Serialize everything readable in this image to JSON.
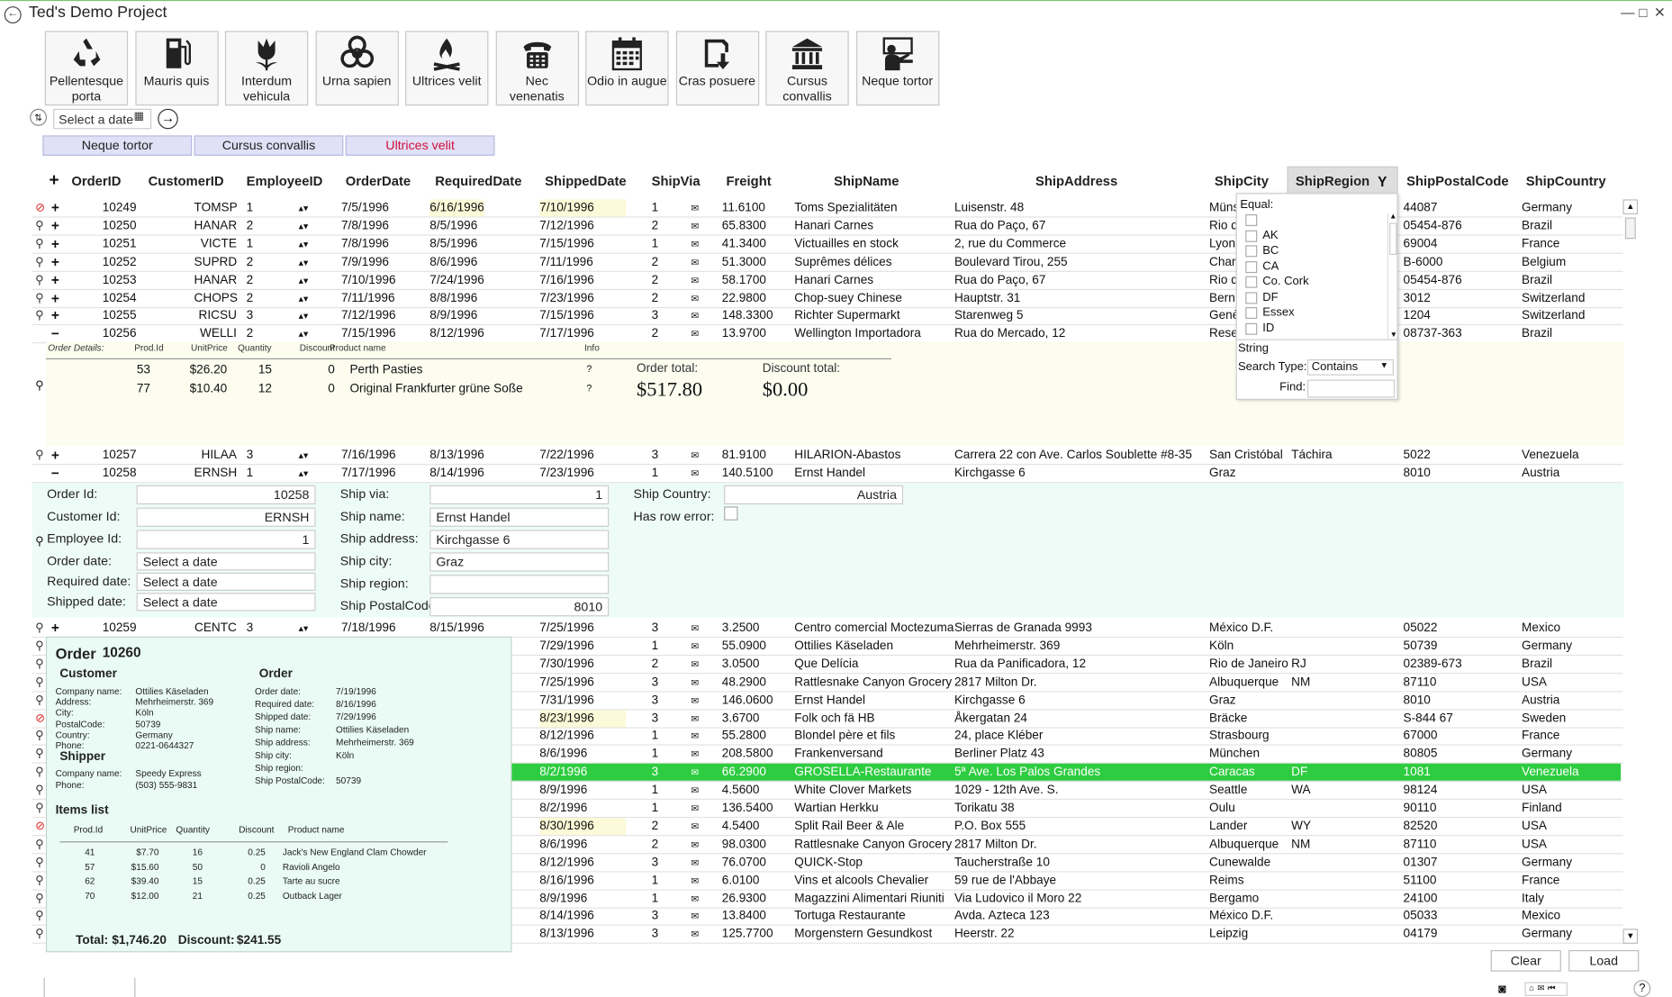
{
  "window": {
    "title": "Ted's Demo Project",
    "controls": [
      "—",
      "□",
      "✕"
    ]
  },
  "toolbar": [
    {
      "label": "Pellentesque porta",
      "icon": "recycle-icon"
    },
    {
      "label": "Mauris quis",
      "icon": "fuel-pump-icon"
    },
    {
      "label": "Interdum vehicula",
      "icon": "tulip-icon"
    },
    {
      "label": "Urna sapien",
      "icon": "biohazard-icon"
    },
    {
      "label": "Ultrices velit",
      "icon": "campfire-icon"
    },
    {
      "label": "Nec venenatis",
      "icon": "telephone-icon"
    },
    {
      "label": "Odio in augue",
      "icon": "calendar-icon"
    },
    {
      "label": "Cras posuere",
      "icon": "save-icon"
    },
    {
      "label": "Cursus convallis",
      "icon": "bank-icon"
    },
    {
      "label": "Neque tortor",
      "icon": "teacher-icon"
    }
  ],
  "date_picker": {
    "placeholder": "Select a date"
  },
  "tabs": [
    {
      "label": "Neque tortor",
      "active": false
    },
    {
      "label": "Cursus convallis",
      "active": false
    },
    {
      "label": "Ultrices velit",
      "active": true
    }
  ],
  "grid": {
    "columns": [
      "OrderID",
      "CustomerID",
      "EmployeeID",
      "OrderDate",
      "RequiredDate",
      "ShippedDate",
      "ShipVia",
      "Freight",
      "ShipName",
      "ShipAddress",
      "ShipCity",
      "ShipRegion",
      "ShipPostalCode",
      "ShipCountry"
    ],
    "rows_top": [
      [
        "10249",
        "TOMSP",
        "1",
        "7/5/1996",
        "6/16/1996",
        "7/10/1996",
        "1",
        "11.6100",
        "Toms Spezialitäten",
        "Luisenstr. 48",
        "Münster",
        "",
        "44087",
        "Germany"
      ],
      [
        "10250",
        "HANAR",
        "2",
        "7/8/1996",
        "8/5/1996",
        "7/12/1996",
        "2",
        "65.8300",
        "Hanari Carnes",
        "Rua do Paço, 67",
        "Rio de Janeiro",
        "",
        "05454-876",
        "Brazil"
      ],
      [
        "10251",
        "VICTE",
        "1",
        "7/8/1996",
        "8/5/1996",
        "7/15/1996",
        "1",
        "41.3400",
        "Victuailles en stock",
        "2, rue du Commerce",
        "Lyon",
        "",
        "69004",
        "France"
      ],
      [
        "10252",
        "SUPRD",
        "2",
        "7/9/1996",
        "8/6/1996",
        "7/11/1996",
        "2",
        "51.3000",
        "Suprêmes délices",
        "Boulevard Tirou, 255",
        "Charleroi",
        "",
        "B-6000",
        "Belgium"
      ],
      [
        "10253",
        "HANAR",
        "2",
        "7/10/1996",
        "7/24/1996",
        "7/16/1996",
        "2",
        "58.1700",
        "Hanari Carnes",
        "Rua do Paço, 67",
        "Rio de Janeiro",
        "",
        "05454-876",
        "Brazil"
      ],
      [
        "10254",
        "CHOPS",
        "2",
        "7/11/1996",
        "8/8/1996",
        "7/23/1996",
        "2",
        "22.9800",
        "Chop-suey Chinese",
        "Hauptstr. 31",
        "Bern",
        "",
        "3012",
        "Switzerland"
      ],
      [
        "10255",
        "RICSU",
        "3",
        "7/12/1996",
        "8/9/1996",
        "7/15/1996",
        "3",
        "148.3300",
        "Richter Supermarkt",
        "Starenweg 5",
        "Genève",
        "",
        "1204",
        "Switzerland"
      ],
      [
        "10256",
        "WELLI",
        "2",
        "7/15/1996",
        "8/12/1996",
        "7/17/1996",
        "2",
        "13.9700",
        "Wellington Importadora",
        "Rua do Mercado, 12",
        "Resende",
        "",
        "08737-363",
        "Brazil"
      ]
    ],
    "order_details": {
      "header": [
        "Order Details:",
        "Prod.Id",
        "UnitPrice",
        "Quantity",
        "Discount",
        "Product name",
        "Info"
      ],
      "items": [
        [
          "53",
          "$26.20",
          "15",
          "0",
          "Perth Pasties",
          "?"
        ],
        [
          "77",
          "$10.40",
          "12",
          "0",
          "Original Frankfurter grüne Soße",
          "?"
        ]
      ],
      "order_total_label": "Order total:",
      "order_total": "$517.80",
      "discount_total_label": "Discount total:",
      "discount_total": "$0.00"
    },
    "rows_mid": [
      [
        "10257",
        "HILAA",
        "3",
        "7/16/1996",
        "8/13/1996",
        "7/22/1996",
        "3",
        "81.9100",
        "HILARION-Abastos",
        "Carrera 22 con Ave. Carlos Soublette #8-35",
        "San Cristóbal",
        "Táchira",
        "5022",
        "Venezuela"
      ],
      [
        "10258",
        "ERNSH",
        "1",
        "7/17/1996",
        "8/14/1996",
        "7/23/1996",
        "1",
        "140.5100",
        "Ernst Handel",
        "Kirchgasse 6",
        "Graz",
        "",
        "8010",
        "Austria"
      ]
    ],
    "edit_form": {
      "order_id_label": "Order Id:",
      "order_id": "10258",
      "customer_id_label": "Customer Id:",
      "customer_id": "ERNSH",
      "employee_id_label": "Employee Id:",
      "employee_id": "1",
      "order_date_label": "Order date:",
      "required_date_label": "Required date:",
      "shipped_date_label": "Shipped date:",
      "date_placeholder": "Select a date",
      "ship_via_label": "Ship via:",
      "ship_via": "1",
      "ship_name_label": "Ship name:",
      "ship_name": "Ernst Handel",
      "ship_address_label": "Ship address:",
      "ship_address": "Kirchgasse 6",
      "ship_city_label": "Ship city:",
      "ship_city": "Graz",
      "ship_region_label": "Ship region:",
      "ship_region": "",
      "ship_postal_label": "Ship PostalCode:",
      "ship_postal": "8010",
      "ship_country_label": "Ship Country:",
      "ship_country": "Austria",
      "row_error_label": "Has row error:"
    },
    "rows_bottom": [
      [
        "10259",
        "CENTC",
        "3",
        "7/18/1996",
        "8/15/1996",
        "7/25/1996",
        "3",
        "3.2500",
        "Centro comercial Moctezuma",
        "Sierras de Granada 9993",
        "México D.F.",
        "",
        "05022",
        "Mexico"
      ],
      [
        "",
        "",
        "",
        "",
        "",
        "7/29/1996",
        "1",
        "55.0900",
        "Ottilies Käseladen",
        "Mehrheimerstr. 369",
        "Köln",
        "",
        "50739",
        "Germany"
      ],
      [
        "",
        "",
        "",
        "",
        "",
        "7/30/1996",
        "2",
        "3.0500",
        "Que Delícia",
        "Rua da Panificadora, 12",
        "Rio de Janeiro",
        "RJ",
        "02389-673",
        "Brazil"
      ],
      [
        "",
        "",
        "",
        "",
        "",
        "7/25/1996",
        "3",
        "48.2900",
        "Rattlesnake Canyon Grocery",
        "2817 Milton Dr.",
        "Albuquerque",
        "NM",
        "87110",
        "USA"
      ],
      [
        "",
        "",
        "",
        "",
        "",
        "7/31/1996",
        "3",
        "146.0600",
        "Ernst Handel",
        "Kirchgasse 6",
        "Graz",
        "",
        "8010",
        "Austria"
      ],
      [
        "",
        "",
        "",
        "",
        "",
        "8/23/1996",
        "3",
        "3.6700",
        "Folk och fä HB",
        "Åkergatan 24",
        "Bräcke",
        "",
        "S-844 67",
        "Sweden"
      ],
      [
        "",
        "",
        "",
        "",
        "",
        "8/12/1996",
        "1",
        "55.2800",
        "Blondel père et fils",
        "24, place Kléber",
        "Strasbourg",
        "",
        "67000",
        "France"
      ],
      [
        "",
        "",
        "",
        "",
        "",
        "8/6/1996",
        "1",
        "208.5800",
        "Frankenversand",
        "Berliner Platz 43",
        "München",
        "",
        "80805",
        "Germany"
      ],
      [
        "",
        "",
        "",
        "",
        "",
        "8/2/1996",
        "3",
        "66.2900",
        "GROSELLA-Restaurante",
        "5ª Ave. Los Palos Grandes",
        "Caracas",
        "DF",
        "1081",
        "Venezuela"
      ],
      [
        "",
        "",
        "",
        "",
        "",
        "8/9/1996",
        "1",
        "4.5600",
        "White Clover Markets",
        "1029 - 12th Ave. S.",
        "Seattle",
        "WA",
        "98124",
        "USA"
      ],
      [
        "",
        "",
        "",
        "",
        "",
        "8/2/1996",
        "1",
        "136.5400",
        "Wartian Herkku",
        "Torikatu 38",
        "Oulu",
        "",
        "90110",
        "Finland"
      ],
      [
        "",
        "",
        "",
        "",
        "",
        "8/30/1996",
        "2",
        "4.5400",
        "Split Rail Beer & Ale",
        "P.O. Box 555",
        "Lander",
        "WY",
        "82520",
        "USA"
      ],
      [
        "",
        "",
        "",
        "",
        "",
        "8/6/1996",
        "2",
        "98.0300",
        "Rattlesnake Canyon Grocery",
        "2817 Milton Dr.",
        "Albuquerque",
        "NM",
        "87110",
        "USA"
      ],
      [
        "",
        "",
        "",
        "",
        "",
        "8/12/1996",
        "3",
        "76.0700",
        "QUICK-Stop",
        "Taucherstraße 10",
        "Cunewalde",
        "",
        "01307",
        "Germany"
      ],
      [
        "",
        "",
        "",
        "",
        "",
        "8/16/1996",
        "1",
        "6.0100",
        "Vins et alcools Chevalier",
        "59 rue de l'Abbaye",
        "Reims",
        "",
        "51100",
        "France"
      ],
      [
        "",
        "",
        "",
        "",
        "",
        "8/9/1996",
        "1",
        "26.9300",
        "Magazzini Alimentari Riuniti",
        "Via Ludovico il Moro 22",
        "Bergamo",
        "",
        "24100",
        "Italy"
      ],
      [
        "",
        "",
        "",
        "",
        "",
        "8/14/1996",
        "3",
        "13.8400",
        "Tortuga Restaurante",
        "Avda. Azteca 123",
        "México D.F.",
        "",
        "05033",
        "Mexico"
      ],
      [
        "",
        "",
        "",
        "",
        "",
        "8/13/1996",
        "3",
        "125.7700",
        "Morgenstern Gesundkost",
        "Heerstr. 22",
        "Leipzig",
        "",
        "04179",
        "Germany"
      ]
    ]
  },
  "filter_popup": {
    "equal_label": "Equal:",
    "options": [
      "",
      "AK",
      "BC",
      "CA",
      "Co. Cork",
      "DF",
      "Essex",
      "ID"
    ],
    "type_label": "String",
    "search_type_label": "Search Type:",
    "search_type": "Contains",
    "find_label": "Find:"
  },
  "tooltip": {
    "title": "Order",
    "order_id": "10260",
    "customer_heading": "Customer",
    "customer": [
      [
        "Company name:",
        "Ottilies Käseladen"
      ],
      [
        "Address:",
        "Mehrheimerstr. 369"
      ],
      [
        "City:",
        "Köln"
      ],
      [
        "PostalCode:",
        "50739"
      ],
      [
        "Country:",
        "Germany"
      ],
      [
        "Phone:",
        "0221-0644327"
      ]
    ],
    "order_heading": "Order",
    "order": [
      [
        "Order date:",
        "7/19/1996"
      ],
      [
        "Required date:",
        "8/16/1996"
      ],
      [
        "Shipped date:",
        "7/29/1996"
      ],
      [
        "Ship name:",
        "Ottilies Käseladen"
      ],
      [
        "Ship address:",
        "Mehrheimerstr. 369"
      ],
      [
        "Ship city:",
        "Köln"
      ],
      [
        "Ship region:",
        ""
      ],
      [
        "Ship PostalCode:",
        "50739"
      ]
    ],
    "shipper_heading": "Shipper",
    "shipper": [
      [
        "Company name:",
        "Speedy Express"
      ],
      [
        "Phone:",
        "(503) 555-9831"
      ]
    ],
    "items_heading": "Items list",
    "items_header": [
      "Prod.Id",
      "UnitPrice",
      "Quantity",
      "Discount",
      "Product name"
    ],
    "items": [
      [
        "41",
        "$7.70",
        "16",
        "0.25",
        "Jack's New England Clam Chowder"
      ],
      [
        "57",
        "$15.60",
        "50",
        "0",
        "Ravioli Angelo"
      ],
      [
        "62",
        "$39.40",
        "15",
        "0.25",
        "Tarte au sucre"
      ],
      [
        "70",
        "$12.00",
        "21",
        "0.25",
        "Outback Lager"
      ]
    ],
    "total_label": "Total:",
    "total": "$1,746.20",
    "discount_label": "Discount:",
    "discount": "$241.55"
  },
  "footer": {
    "clear_label": "Clear",
    "load_label": "Load",
    "help_label": "?"
  },
  "colors": {
    "selected_row": "#2ecc40",
    "tab_active_text": "#d0103a",
    "tab_bg": "#e0e0f6",
    "detail_bg": "#eefcf7",
    "expander_bg": "#fcfdef"
  }
}
